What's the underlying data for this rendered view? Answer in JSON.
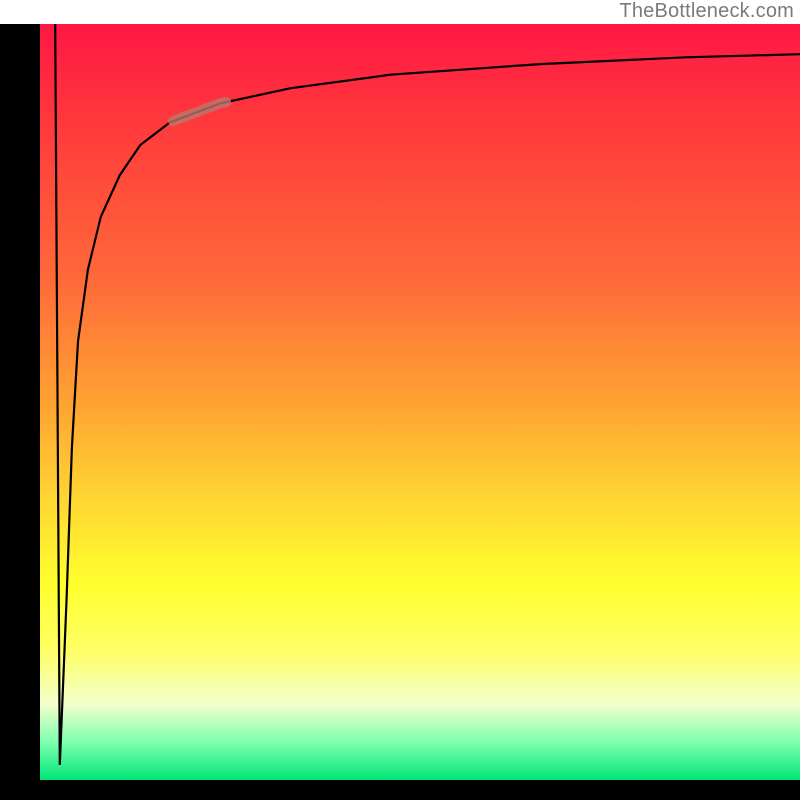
{
  "attribution": "TheBottleneck.com",
  "colors": {
    "frame": "#000000",
    "gradient_top": "#ff1744",
    "gradient_mid1": "#ffa231",
    "gradient_mid2": "#ffff2d",
    "gradient_bottom": "#00e676",
    "curve": "#000000",
    "hump": "#b97a6e"
  },
  "chart_data": {
    "type": "line",
    "title": "",
    "xlabel": "",
    "ylabel": "",
    "xlim": [
      0,
      100
    ],
    "ylim": [
      0,
      100
    ],
    "series": [
      {
        "name": "curve",
        "x": [
          2.0,
          2.6,
          3.5,
          4.2,
          5.0,
          6.3,
          8.0,
          10.5,
          13.2,
          17.1,
          23.7,
          32.9,
          46.1,
          65.8,
          85.0,
          100.0
        ],
        "y": [
          100.0,
          2.0,
          24.0,
          44.0,
          58.0,
          67.5,
          74.5,
          80.0,
          84.0,
          87.0,
          89.5,
          91.5,
          93.3,
          94.7,
          95.6,
          96.0
        ]
      }
    ],
    "annotations": [
      {
        "name": "hump-segment",
        "x_range": [
          17.5,
          24.5
        ],
        "note": "thick light-brown segment overlaid on curve"
      }
    ]
  }
}
